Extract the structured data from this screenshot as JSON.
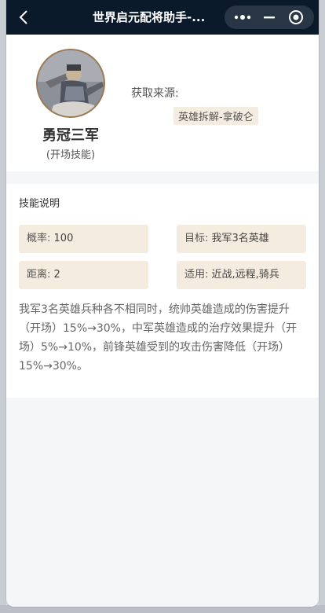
{
  "app": {
    "title": "世界启元配将助手-..."
  },
  "capsule": {
    "more_icon": "more-dots-icon",
    "minimize_icon": "minus-icon",
    "close_icon": "target-circle-icon"
  },
  "skill": {
    "name": "勇冠三军",
    "type": "(开场技能)",
    "source_label": "获取来源:",
    "source_value": "英雄拆解-拿破仑"
  },
  "details": {
    "title": "技能说明",
    "attributes": [
      {
        "label": "概率:",
        "value": "100"
      },
      {
        "label": "目标:",
        "value": "我军3名英雄"
      },
      {
        "label": "距离:",
        "value": "2"
      },
      {
        "label": "适用:",
        "value": "近战,远程,骑兵"
      }
    ],
    "description": "我军3名英雄兵种各不相同时，统帅英雄造成的伤害提升（开场）15%→30%，中军英雄造成的治疗效果提升（开场）5%→10%，前锋英雄受到的攻击伤害降低（开场）15%→30%。"
  },
  "colors": {
    "titlebar": "#0b1a2b",
    "tag_bg": "#f4ecdf",
    "page_bg": "#f5f6f8"
  }
}
